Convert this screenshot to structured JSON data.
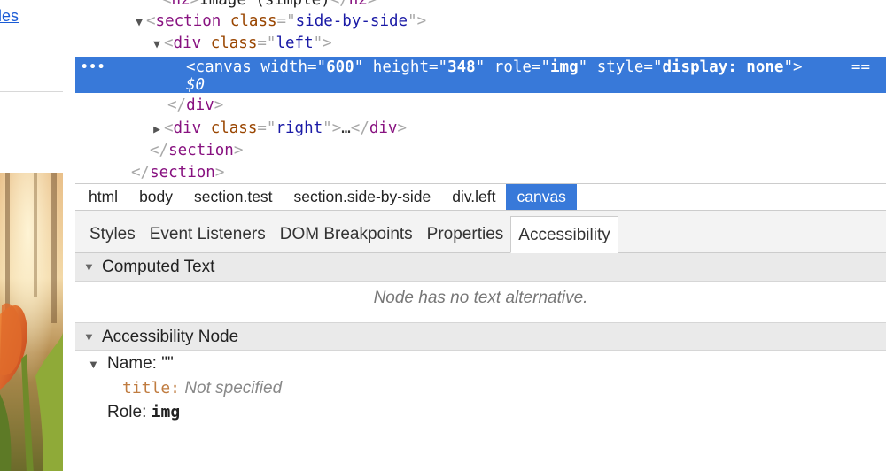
{
  "page": {
    "link_text": "les"
  },
  "dom_tree": {
    "lines": [
      {
        "tag": "h2",
        "text": "Image (simple)"
      },
      {
        "tag": "section",
        "class_attr": "class",
        "class_val": "side-by-side"
      },
      {
        "tag": "div",
        "class_attr": "class",
        "class_val": "left"
      },
      {
        "tag": "canvas",
        "attrs": [
          {
            "name": "width",
            "value": "600"
          },
          {
            "name": "height",
            "value": "348"
          },
          {
            "name": "role",
            "value": "img"
          },
          {
            "name": "style",
            "value": "display: none"
          }
        ],
        "eq": "==",
        "ref": "$0"
      },
      {
        "close_tag": "div"
      },
      {
        "tag": "div",
        "class_attr": "class",
        "class_val": "right",
        "ellipsis": "…",
        "close_tag": "div"
      },
      {
        "close_tag": "section"
      },
      {
        "close_tag": "section"
      }
    ]
  },
  "breadcrumb": [
    "html",
    "body",
    "section.test",
    "section.side-by-side",
    "div.left",
    "canvas"
  ],
  "tabs": [
    "Styles",
    "Event Listeners",
    "DOM Breakpoints",
    "Properties",
    "Accessibility"
  ],
  "accessibility": {
    "computed_text": {
      "title": "Computed Text",
      "message": "Node has no text alternative."
    },
    "node": {
      "title": "Accessibility Node",
      "name_label": "Name:",
      "name_value": "\"\"",
      "title_prop": "title:",
      "title_value": "Not specified",
      "role_label": "Role:",
      "role_value": "img"
    }
  },
  "colors": {
    "selection": "#3879d9",
    "tag": "#881280",
    "attr": "#994500",
    "value": "#1a1aa6"
  }
}
